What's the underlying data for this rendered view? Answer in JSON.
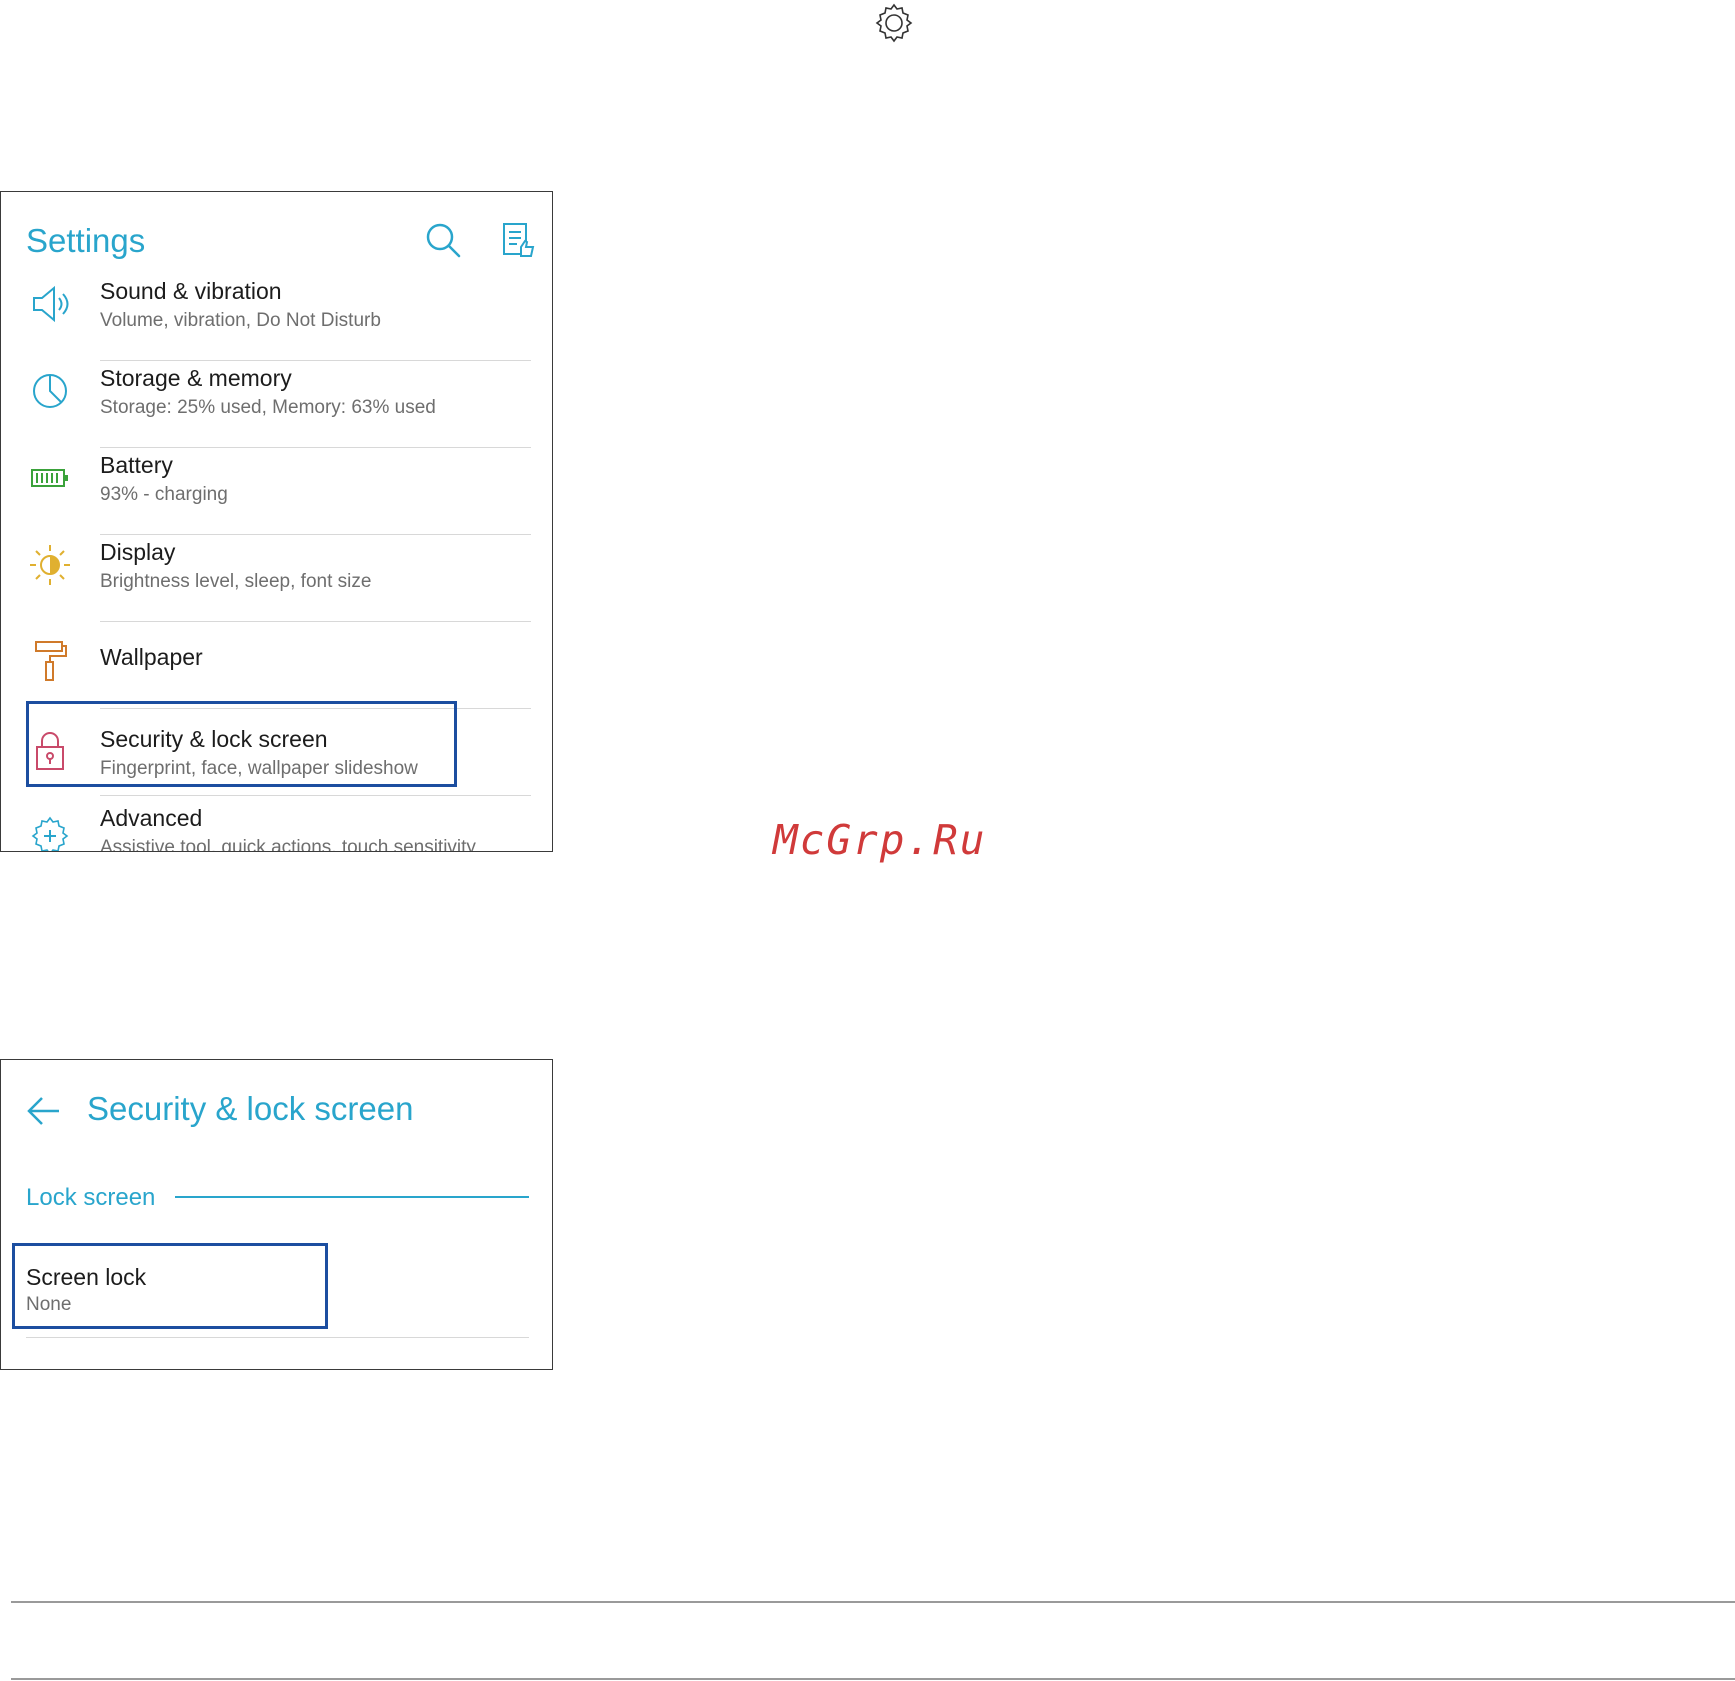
{
  "settings_panel": {
    "title": "Settings",
    "items": [
      {
        "label": "Sound & vibration",
        "sub": "Volume, vibration, Do Not Disturb",
        "icon": "speaker-icon"
      },
      {
        "label": "Storage & memory",
        "sub": "Storage: 25% used, Memory: 63% used",
        "icon": "pie-chart-icon"
      },
      {
        "label": "Battery",
        "sub": "93% - charging",
        "icon": "battery-icon"
      },
      {
        "label": "Display",
        "sub": "Brightness level, sleep, font size",
        "icon": "brightness-icon"
      },
      {
        "label": "Wallpaper",
        "sub": "",
        "icon": "paint-roller-icon"
      },
      {
        "label": "Security & lock screen",
        "sub": "Fingerprint, face, wallpaper slideshow",
        "icon": "lock-icon"
      },
      {
        "label": "Advanced",
        "sub": "Assistive tool, quick actions, touch sensitivity",
        "icon": "gear-plus-icon"
      }
    ]
  },
  "security_panel": {
    "title": "Security & lock screen",
    "section": "Lock screen",
    "item_label": "Screen lock",
    "item_value": "None"
  },
  "watermark": "McGrp.Ru",
  "colors": {
    "accent": "#29a5cc",
    "highlight": "#1c4ea0",
    "battery": "#3aa23a",
    "display": "#e0b030",
    "wallpaper": "#d07a2a",
    "lock": "#c94a6a"
  }
}
